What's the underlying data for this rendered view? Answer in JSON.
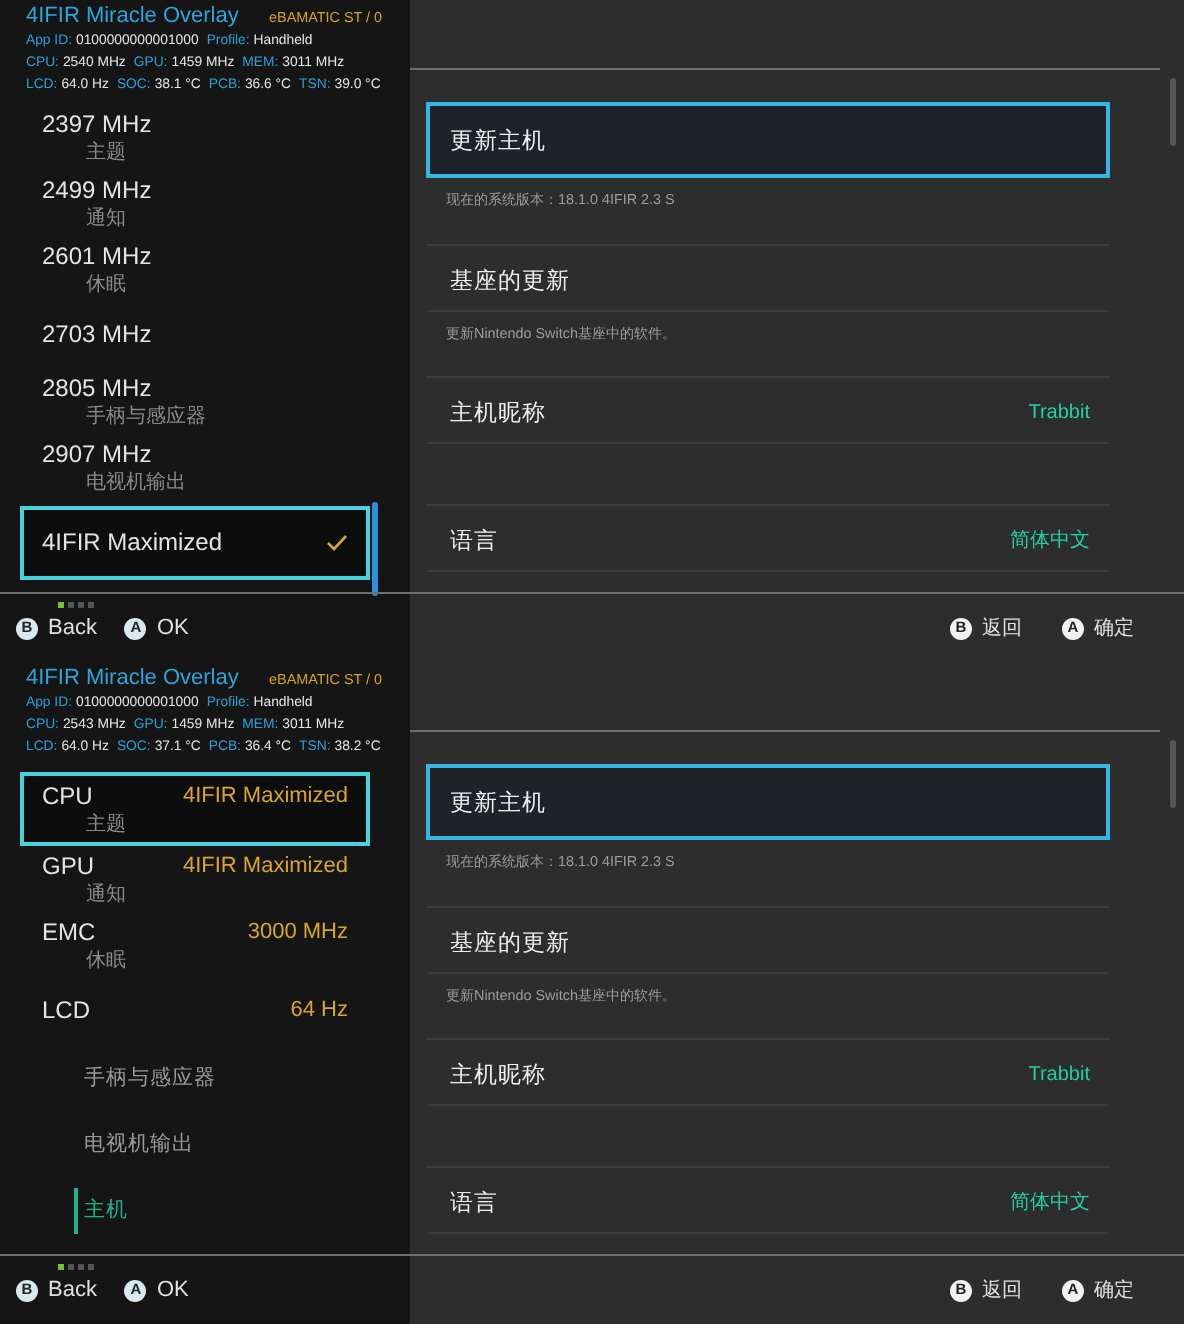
{
  "screens": [
    {
      "overlay": {
        "title": "4IFIR Miracle Overlay",
        "mode": "eBAMATIC ST / 0",
        "stats": [
          [
            {
              "label": "App ID:",
              "value": "0100000000001000"
            },
            {
              "label": "Profile:",
              "value": "Handheld"
            }
          ],
          [
            {
              "label": "CPU:",
              "value": "2540 MHz"
            },
            {
              "label": "GPU:",
              "value": "1459 MHz"
            },
            {
              "label": "MEM:",
              "value": "3011 MHz"
            }
          ],
          [
            {
              "label": "LCD:",
              "value": "64.0 Hz"
            },
            {
              "label": "SOC:",
              "value": "38.1 °C"
            },
            {
              "label": "PCB:",
              "value": "36.6 °C"
            },
            {
              "label": "TSN:",
              "value": "39.0 °C"
            }
          ]
        ]
      },
      "left_list": [
        {
          "kind": "option",
          "label": "2397 MHz",
          "behind": "主题",
          "selected": false,
          "checked": false
        },
        {
          "kind": "option",
          "label": "2499 MHz",
          "behind": "通知",
          "selected": false,
          "checked": false
        },
        {
          "kind": "option",
          "label": "2601 MHz",
          "behind": "休眠",
          "selected": false,
          "checked": false
        },
        {
          "kind": "option",
          "label": "2703 MHz",
          "selected": false,
          "checked": false
        },
        {
          "kind": "option",
          "label": "2805 MHz",
          "behind": "手柄与感应器",
          "selected": false,
          "checked": false
        },
        {
          "kind": "option",
          "label": "2907 MHz",
          "behind": "电视机输出",
          "selected": false,
          "checked": false
        },
        {
          "kind": "option",
          "label": "4IFIR Maximized",
          "selected": true,
          "checked": true
        }
      ],
      "left_footer": {
        "pages": [
          {
            "selected": true
          },
          {
            "selected": false
          },
          {
            "selected": false
          },
          {
            "selected": false
          }
        ],
        "buttons": [
          {
            "key": "B",
            "label": "Back"
          },
          {
            "key": "A",
            "label": "OK"
          }
        ]
      },
      "settings": [
        {
          "kind": "entry",
          "title": "更新主机",
          "desc": "现在的系统版本：18.1.0 4IFIR 2.3 S",
          "selected": true
        },
        {
          "kind": "entry",
          "title": "基座的更新",
          "desc": "更新Nintendo Switch基座中的软件。",
          "selected": false
        },
        {
          "kind": "entry",
          "title": "主机昵称",
          "value": "Trabbit",
          "selected": false
        },
        {
          "kind": "spacer"
        },
        {
          "kind": "entry",
          "title": "语言",
          "value": "简体中文",
          "selected": false
        }
      ],
      "footer_buttons": [
        {
          "key": "B",
          "label": "返回"
        },
        {
          "key": "A",
          "label": "确定"
        }
      ]
    },
    {
      "overlay": {
        "title": "4IFIR Miracle Overlay",
        "mode": "eBAMATIC ST / 0",
        "stats": [
          [
            {
              "label": "App ID:",
              "value": "0100000000001000"
            },
            {
              "label": "Profile:",
              "value": "Handheld"
            }
          ],
          [
            {
              "label": "CPU:",
              "value": "2543 MHz"
            },
            {
              "label": "GPU:",
              "value": "1459 MHz"
            },
            {
              "label": "MEM:",
              "value": "3011 MHz"
            }
          ],
          [
            {
              "label": "LCD:",
              "value": "64.0 Hz"
            },
            {
              "label": "SOC:",
              "value": "37.1 °C"
            },
            {
              "label": "PCB:",
              "value": "36.4 °C"
            },
            {
              "label": "TSN:",
              "value": "38.2 °C"
            }
          ]
        ]
      },
      "left_list": [
        {
          "kind": "setting",
          "label": "CPU",
          "value": "4IFIR Maximized",
          "behind": "主题",
          "selected": true
        },
        {
          "kind": "setting",
          "label": "GPU",
          "value": "4IFIR Maximized",
          "behind": "通知",
          "selected": false
        },
        {
          "kind": "setting",
          "label": "EMC",
          "value": "3000 MHz",
          "behind": "休眠",
          "selected": false
        },
        {
          "kind": "setting",
          "label": "LCD",
          "value": "64 Hz",
          "selected": false
        },
        {
          "kind": "menu",
          "label": "手柄与感应器",
          "selected": false
        },
        {
          "kind": "menu",
          "label": "电视机输出",
          "selected": false
        },
        {
          "kind": "menu",
          "label": "主机",
          "selected": true
        }
      ],
      "left_footer": {
        "pages": [
          {
            "selected": true
          },
          {
            "selected": false
          },
          {
            "selected": false
          },
          {
            "selected": false
          }
        ],
        "buttons": [
          {
            "key": "B",
            "label": "Back"
          },
          {
            "key": "A",
            "label": "OK"
          }
        ]
      },
      "settings": [
        {
          "kind": "entry",
          "title": "更新主机",
          "desc": "现在的系统版本：18.1.0 4IFIR 2.3 S",
          "selected": true
        },
        {
          "kind": "entry",
          "title": "基座的更新",
          "desc": "更新Nintendo Switch基座中的软件。",
          "selected": false
        },
        {
          "kind": "entry",
          "title": "主机昵称",
          "value": "Trabbit",
          "selected": false
        },
        {
          "kind": "spacer"
        },
        {
          "kind": "entry",
          "title": "语言",
          "value": "简体中文",
          "selected": false
        }
      ],
      "footer_buttons": [
        {
          "key": "B",
          "label": "返回"
        },
        {
          "key": "A",
          "label": "确定"
        }
      ]
    }
  ]
}
